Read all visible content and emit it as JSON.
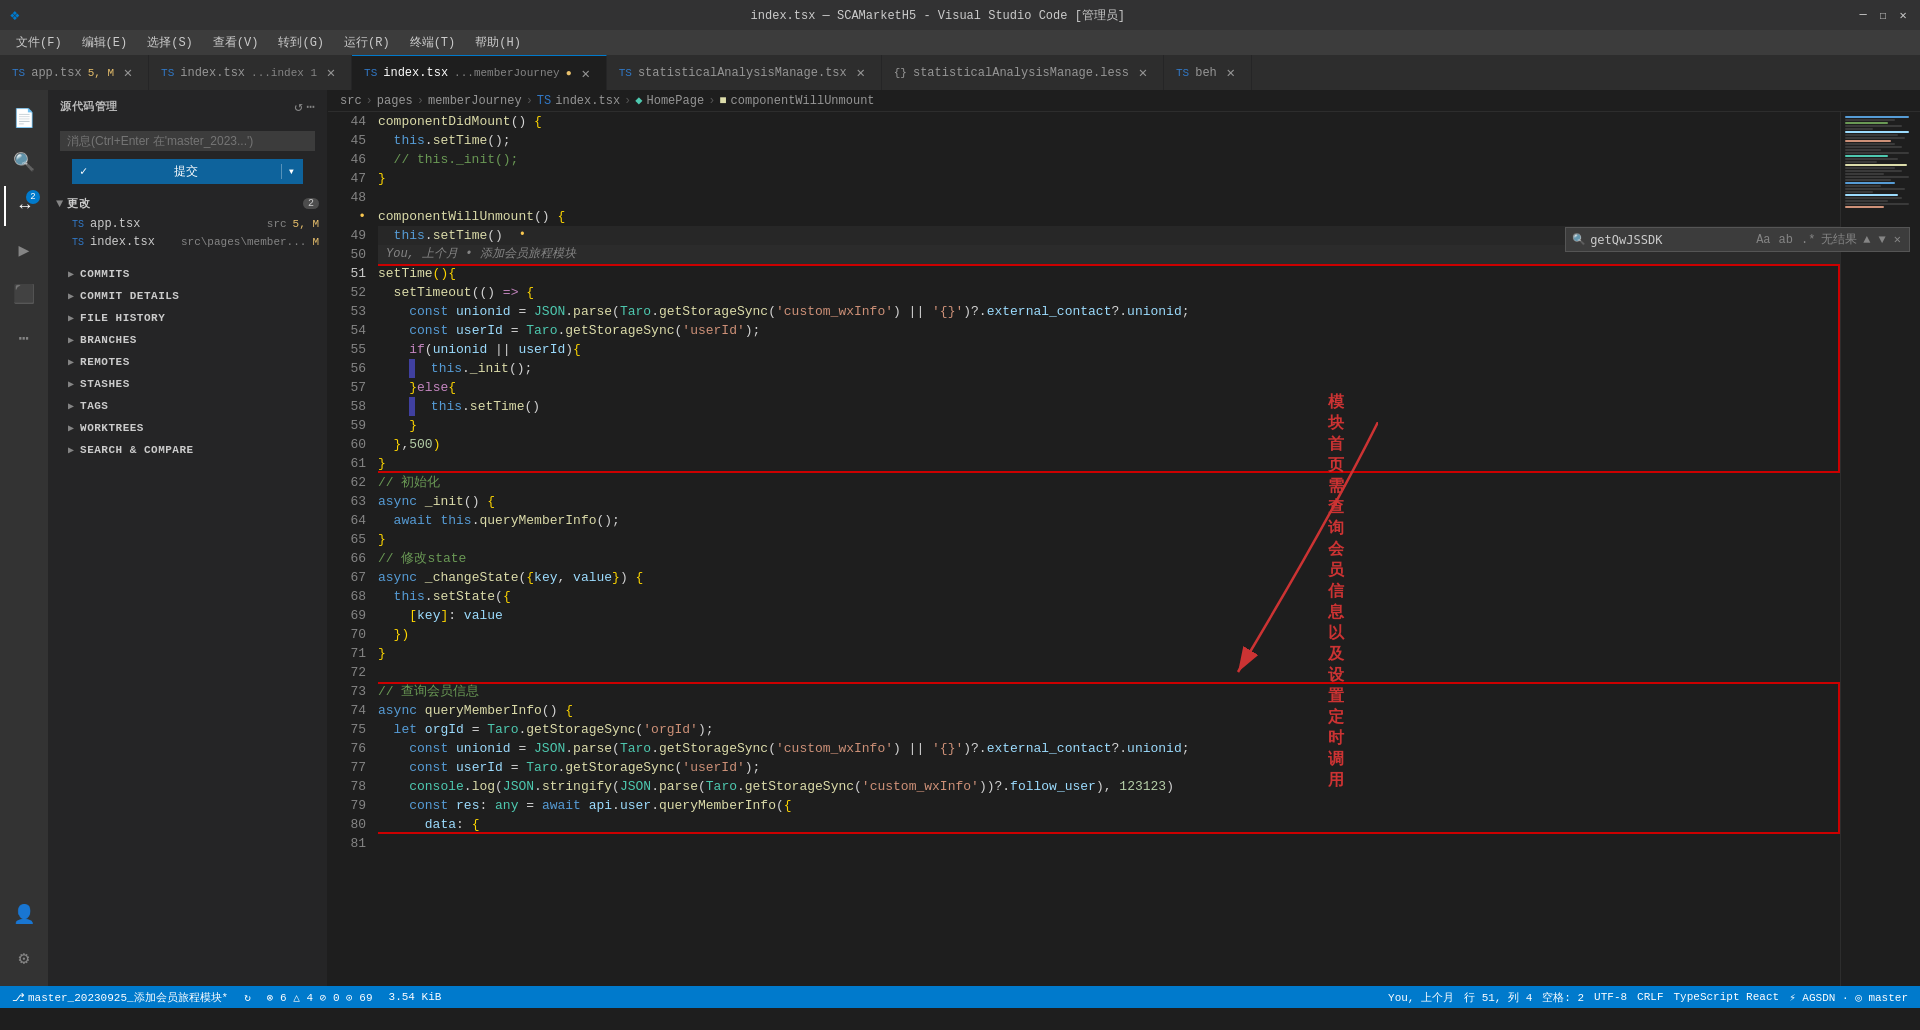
{
  "titleBar": {
    "title": "index.tsx — SCAMarketH5 - Visual Studio Code [管理员]",
    "windowControls": [
      "minimize",
      "maximize",
      "close"
    ]
  },
  "menuBar": {
    "items": [
      "文件(F)",
      "编辑(E)",
      "选择(S)",
      "查看(V)",
      "转到(G)",
      "运行(R)",
      "终端(T)",
      "帮助(H)"
    ]
  },
  "tabs": [
    {
      "id": "app-tsx",
      "icon": "TS",
      "label": "app.tsx",
      "badge": "5, M",
      "active": false,
      "modified": true
    },
    {
      "id": "index-tsx-1",
      "icon": "TS",
      "label": "index.tsx",
      "badge": "...index 1",
      "active": false,
      "modified": false
    },
    {
      "id": "index-tsx-main",
      "icon": "TS",
      "label": "index.tsx",
      "path": "...memberJourney",
      "badge": "M",
      "active": true,
      "modified": true
    },
    {
      "id": "statistical-tsx",
      "icon": "TS",
      "label": "statisticalAnalysisManage.tsx",
      "active": false,
      "modified": false
    },
    {
      "id": "statistical-less",
      "icon": "{}",
      "label": "statisticalAnalysisManage.less",
      "active": false,
      "modified": false
    },
    {
      "id": "beh",
      "icon": "TS",
      "label": "beh",
      "active": false,
      "modified": false
    }
  ],
  "breadcrumb": {
    "items": [
      "src",
      "pages",
      "memberJourney",
      "TS index.tsx",
      "HomePage",
      "componentWillUnmount"
    ]
  },
  "searchBar": {
    "value": "getQwJSSDK",
    "placeholder": "getQwJSSDK",
    "noResults": "无结果"
  },
  "sidebar": {
    "title": "源代码管理",
    "searchPlaceholder": "消息(Ctrl+Enter 在'master_2023...')",
    "commitBtn": "✓ 提交",
    "changesSection": "更改",
    "changesCount": 2,
    "files": [
      {
        "name": "app.tsx",
        "path": "src",
        "status": "5, M"
      },
      {
        "name": "index.tsx",
        "path": "src\\pages\\member...",
        "status": "M"
      }
    ],
    "sections": [
      {
        "label": "COMMITS",
        "expanded": false
      },
      {
        "label": "COMMIT DETAILS",
        "expanded": false
      },
      {
        "label": "FILE HISTORY",
        "expanded": false
      },
      {
        "label": "BRANCHES",
        "expanded": false
      },
      {
        "label": "REMOTES",
        "expanded": false
      },
      {
        "label": "STASHES",
        "expanded": false
      },
      {
        "label": "TAGS",
        "expanded": false
      },
      {
        "label": "WORKTREES",
        "expanded": false
      },
      {
        "label": "SEARCH & COMPARE",
        "expanded": false
      }
    ]
  },
  "codeLines": [
    {
      "num": 44,
      "content": "componentDidMount() {",
      "type": "normal"
    },
    {
      "num": 45,
      "content": "  this.setTime();",
      "type": "normal"
    },
    {
      "num": 46,
      "content": "  // this._init();",
      "type": "comment"
    },
    {
      "num": 47,
      "content": "}",
      "type": "normal"
    },
    {
      "num": 48,
      "content": "",
      "type": "normal"
    },
    {
      "num": 49,
      "content": "componentWillUnmount() {",
      "type": "normal",
      "active": true
    },
    {
      "num": 50,
      "content": "  this.setTime()",
      "type": "normal"
    },
    {
      "num": 51,
      "content": "  ",
      "type": "blame"
    },
    {
      "num": 52,
      "content": "setTime(){",
      "type": "normal"
    },
    {
      "num": 53,
      "content": "  setTimeout(() => {",
      "type": "normal"
    },
    {
      "num": 54,
      "content": "    const unionid = JSON.parse(Taro.getStorageSync('custom_wxInfo') || '{}')?.external_contact?.unionid;",
      "type": "normal"
    },
    {
      "num": 55,
      "content": "    const userId = Taro.getStorageSync('userId');",
      "type": "normal"
    },
    {
      "num": 56,
      "content": "    if(unionid || userId){",
      "type": "normal"
    },
    {
      "num": 57,
      "content": "      this._init();",
      "type": "normal"
    },
    {
      "num": 58,
      "content": "    }else{",
      "type": "normal"
    },
    {
      "num": 59,
      "content": "      this.setTime()",
      "type": "normal"
    },
    {
      "num": 60,
      "content": "    }",
      "type": "normal"
    },
    {
      "num": 61,
      "content": "  },500)",
      "type": "normal"
    },
    {
      "num": 62,
      "content": "}",
      "type": "normal"
    },
    {
      "num": 63,
      "content": "// 初始化",
      "type": "comment"
    },
    {
      "num": 64,
      "content": "async _init() {",
      "type": "normal"
    },
    {
      "num": 65,
      "content": "  await this.queryMemberInfo();",
      "type": "normal"
    },
    {
      "num": 66,
      "content": "}",
      "type": "normal"
    },
    {
      "num": 67,
      "content": "// 修改state",
      "type": "comment"
    },
    {
      "num": 68,
      "content": "async _changeState({key, value}) {",
      "type": "normal"
    },
    {
      "num": 69,
      "content": "  this.setState({",
      "type": "normal"
    },
    {
      "num": 70,
      "content": "    [key]: value",
      "type": "normal"
    },
    {
      "num": 71,
      "content": "  })",
      "type": "normal"
    },
    {
      "num": 72,
      "content": "}",
      "type": "normal"
    },
    {
      "num": 73,
      "content": "",
      "type": "normal"
    },
    {
      "num": 74,
      "content": "// 查询会员信息",
      "type": "comment"
    },
    {
      "num": 75,
      "content": "async queryMemberInfo() {",
      "type": "normal"
    },
    {
      "num": 76,
      "content": "  let orgId = Taro.getStorageSync('orgId');",
      "type": "normal"
    },
    {
      "num": 77,
      "content": "    const unionid = JSON.parse(Taro.getStorageSync('custom_wxInfo') || '{}')?.external_contact?.unionid;",
      "type": "normal"
    },
    {
      "num": 78,
      "content": "    const userId = Taro.getStorageSync('userId');",
      "type": "normal"
    },
    {
      "num": 79,
      "content": "    console.log(JSON.stringify(JSON.parse(Taro.getStorageSync('custom_wxInfo'))?.follow_user), 123123)",
      "type": "normal"
    },
    {
      "num": 80,
      "content": "    const res: any = await api.user.queryMemberInfo({",
      "type": "normal"
    },
    {
      "num": 81,
      "content": "      data: {",
      "type": "normal"
    }
  ],
  "annotation": {
    "text": "模块首页需查询会员信息以及设置定时调用"
  },
  "statusBar": {
    "branch": "master_20230925_添加会员旅程模块*",
    "sync": "",
    "errors": "⊗ 6 △ 4 ⊘ 0 ⊙ 69",
    "size": "3.54 KiB",
    "blame": "You, 上个月",
    "position": "行 51, 列 4",
    "spaces": "空格: 2",
    "encoding": "UTF-8",
    "lineEnding": "CRLF",
    "language": "TypeScript React",
    "gitlens": "⚡ AGSDN · ◎ master"
  }
}
